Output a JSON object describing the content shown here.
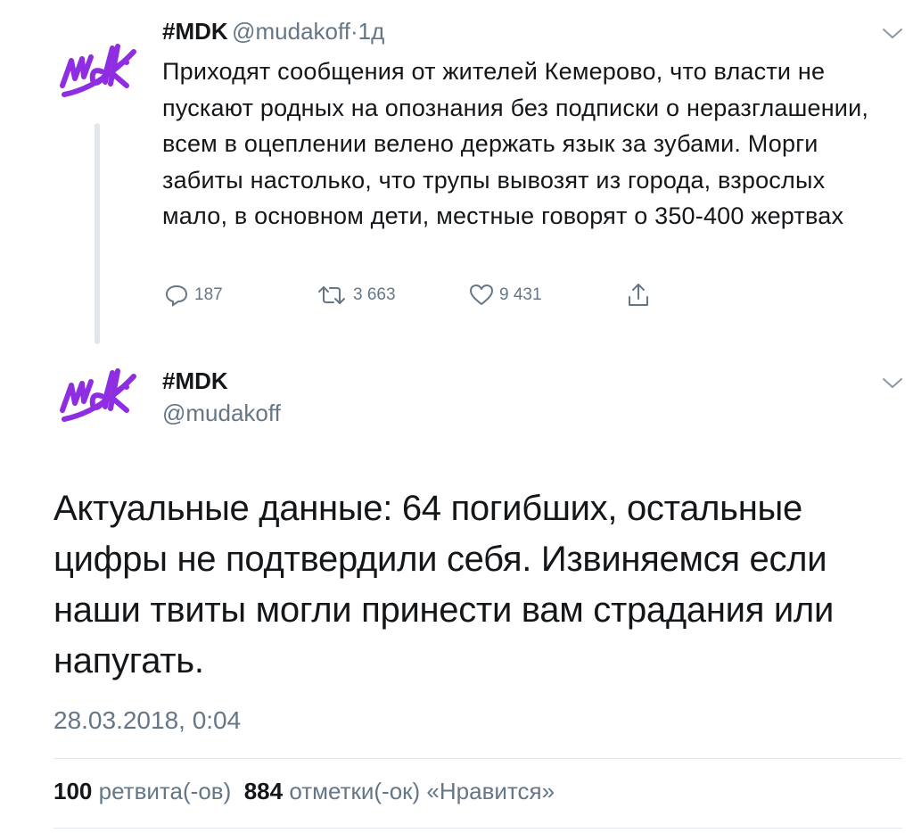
{
  "first_tweet": {
    "name": "#MDK",
    "handle": "@mudakoff",
    "separator": "·",
    "age": "1д",
    "text": "Приходят сообщения от жителей Кемерово, что власти не пускают родных на опознания без подписки о неразглашении, всем в оцеплении велено держать язык за зубами. Морги забиты настолько, что трупы вывозят из города, взрослых мало, в основном дети, местные говорят о 350-400 жертвах",
    "replies": "187",
    "retweets": "3 663",
    "likes": "9 431"
  },
  "main_tweet": {
    "name": "#MDK",
    "handle": "@mudakoff",
    "text": "Актуальные данные: 64 погибших, остальные цифры не подтвердили себя. Извиняемся если наши твиты могли принести вам страдания или напугать.",
    "timestamp": "28.03.2018, 0:04",
    "retweet_count": "100",
    "retweet_label": "ретвита(-ов)",
    "like_count": "884",
    "like_label": "отметки(-ок) «Нравится»"
  },
  "avatar_lettering": "mdk",
  "colors": {
    "avatar": "#8e2de2",
    "secondary_text": "#657786",
    "primary_text": "#14171a",
    "divider": "#e1e8ed"
  },
  "icons": [
    "reply-icon",
    "retweet-icon",
    "like-icon",
    "share-icon",
    "chevron-down-icon"
  ]
}
